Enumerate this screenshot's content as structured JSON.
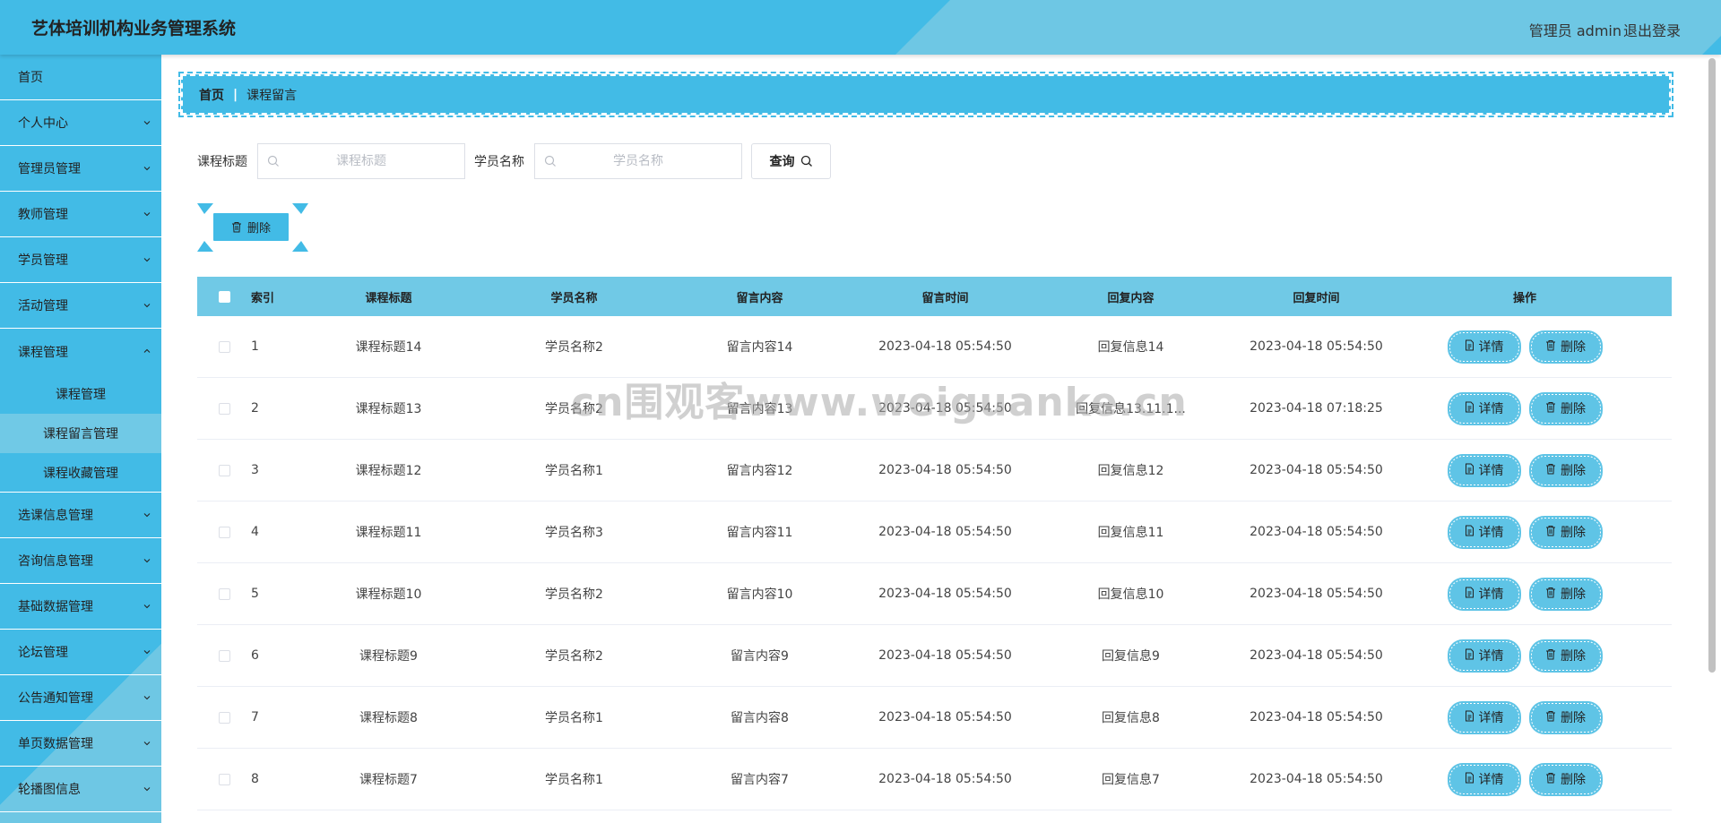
{
  "header": {
    "title": "艺体培训机构业务管理系统",
    "user": "管理员 admin",
    "logout": "退出登录"
  },
  "sidebar": {
    "items": [
      {
        "label": "首页"
      },
      {
        "label": "个人中心"
      },
      {
        "label": "管理员管理"
      },
      {
        "label": "教师管理"
      },
      {
        "label": "学员管理"
      },
      {
        "label": "活动管理"
      },
      {
        "label": "课程管理"
      },
      {
        "label": "选课信息管理"
      },
      {
        "label": "咨询信息管理"
      },
      {
        "label": "基础数据管理"
      },
      {
        "label": "论坛管理"
      },
      {
        "label": "公告通知管理"
      },
      {
        "label": "单页数据管理"
      },
      {
        "label": "轮播图信息"
      }
    ],
    "sub": [
      {
        "label": "课程管理"
      },
      {
        "label": "课程留言管理"
      },
      {
        "label": "课程收藏管理"
      }
    ]
  },
  "breadcrumb": {
    "home": "首页",
    "sep": "|",
    "current": "课程留言"
  },
  "search": {
    "title_label": "课程标题",
    "title_placeholder": "课程标题",
    "student_label": "学员名称",
    "student_placeholder": "学员名称",
    "query": "查询"
  },
  "actions": {
    "delete": "删除"
  },
  "table": {
    "headers": [
      "索引",
      "课程标题",
      "学员名称",
      "留言内容",
      "留言时间",
      "回复内容",
      "回复时间",
      "操作"
    ],
    "rows": [
      [
        "1",
        "课程标题14",
        "学员名称2",
        "留言内容14",
        "2023-04-18 05:54:50",
        "回复信息14",
        "2023-04-18 05:54:50"
      ],
      [
        "2",
        "课程标题13",
        "学员名称2",
        "留言内容13",
        "2023-04-18 05:54:50",
        "回复信息13.11.1...",
        "2023-04-18 07:18:25"
      ],
      [
        "3",
        "课程标题12",
        "学员名称1",
        "留言内容12",
        "2023-04-18 05:54:50",
        "回复信息12",
        "2023-04-18 05:54:50"
      ],
      [
        "4",
        "课程标题11",
        "学员名称3",
        "留言内容11",
        "2023-04-18 05:54:50",
        "回复信息11",
        "2023-04-18 05:54:50"
      ],
      [
        "5",
        "课程标题10",
        "学员名称2",
        "留言内容10",
        "2023-04-18 05:54:50",
        "回复信息10",
        "2023-04-18 05:54:50"
      ],
      [
        "6",
        "课程标题9",
        "学员名称2",
        "留言内容9",
        "2023-04-18 05:54:50",
        "回复信息9",
        "2023-04-18 05:54:50"
      ],
      [
        "7",
        "课程标题8",
        "学员名称1",
        "留言内容8",
        "2023-04-18 05:54:50",
        "回复信息8",
        "2023-04-18 05:54:50"
      ],
      [
        "8",
        "课程标题7",
        "学员名称1",
        "留言内容7",
        "2023-04-18 05:54:50",
        "回复信息7",
        "2023-04-18 05:54:50"
      ]
    ],
    "detail_label": "详情",
    "delete_label": "删除"
  },
  "watermark": "cn围观客www.weiguanke.cn",
  "colors": {
    "primary": "#42bbe6",
    "light": "#70c9e6",
    "stripe": "#6ec7e4"
  }
}
